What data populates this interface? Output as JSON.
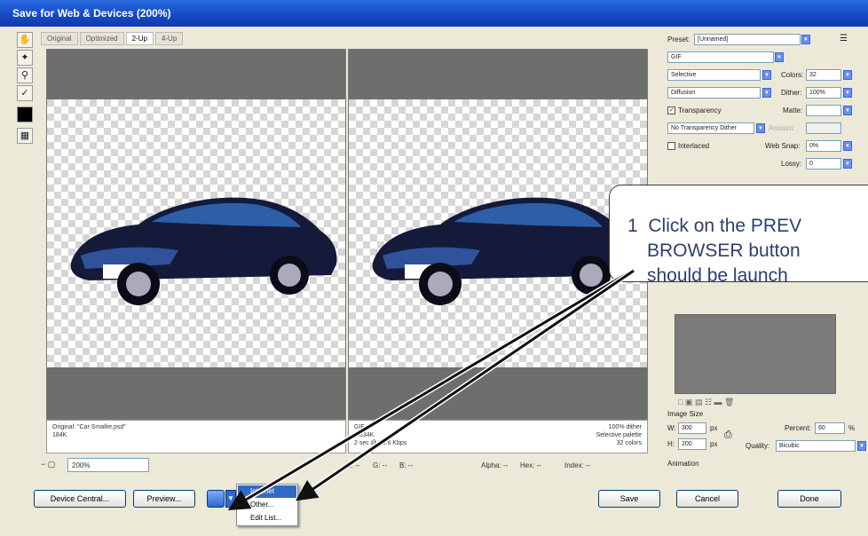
{
  "window": {
    "title": "Save for Web & Devices (200%)"
  },
  "tabs": [
    "Original",
    "Optimized",
    "2-Up",
    "4-Up"
  ],
  "tabs_active": 2,
  "panes": {
    "original": {
      "line1": "Original: \"Car Smaller.psd\"",
      "line2": "184K"
    },
    "optimized": {
      "line1": "GIF",
      "line2": "7.834K",
      "line3": "2 sec @ 56.6 Kbps",
      "right1": "100% dither",
      "right2": "Selective palette",
      "right3": "32 colors"
    }
  },
  "status": {
    "zoom": "200%",
    "r": "R: --",
    "g": "G: --",
    "b": "B: --",
    "alpha": "Alpha: --",
    "hex": "Hex: --",
    "index": "Index: --"
  },
  "buttons": {
    "device_central": "Device Central...",
    "preview": "Preview...",
    "save": "Save",
    "cancel": "Cancel",
    "done": "Done"
  },
  "browser_menu": [
    "Internet Explorer",
    "Other...",
    "Edit List..."
  ],
  "settings": {
    "preset_label": "Preset:",
    "preset_value": "[Unnamed]",
    "format": "GIF",
    "reduction": "Selective",
    "colors_label": "Colors:",
    "colors_value": "32",
    "dither_algo": "Diffusion",
    "dither_label": "Dither:",
    "dither_value": "100%",
    "transparency": "Transparency",
    "matte_label": "Matte:",
    "trans_dither": "No Transparency Dither",
    "amount_label": "Amount:",
    "interlaced": "Interlaced",
    "websnap_label": "Web Snap:",
    "websnap_value": "0%",
    "lossy_label": "Lossy:",
    "lossy_value": "0"
  },
  "image_size": {
    "title": "Image Size",
    "w_label": "W:",
    "w_value": "300",
    "h_label": "H:",
    "h_value": "200",
    "unit": "px",
    "percent_label": "Percent:",
    "percent_value": "60",
    "percent_unit": "%",
    "quality_label": "Quality:",
    "quality_value": "Bicubic"
  },
  "animation": {
    "title": "Animation"
  },
  "callout": {
    "number": "1",
    "line1": "Click on the PREV",
    "line2": "BROWSER button",
    "line3": "should be launch"
  },
  "colors": {
    "titlebar": "#1547c7",
    "accent": "#316ac5"
  }
}
